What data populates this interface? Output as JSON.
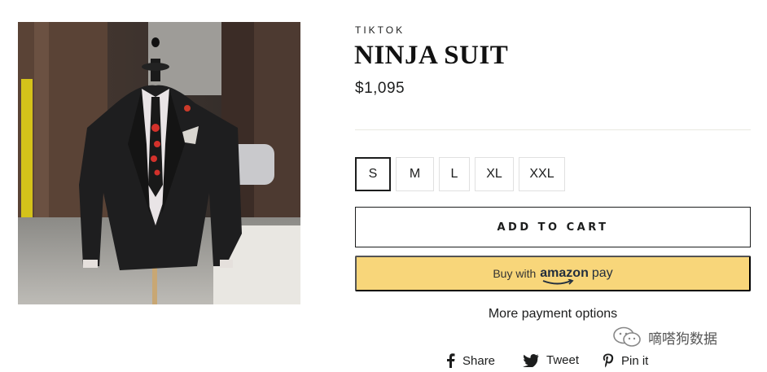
{
  "product": {
    "vendor": "TIKTOK",
    "title": "NINJA SUIT",
    "price": "$1,095",
    "image_icon": "product-photo"
  },
  "sizes": {
    "selected": "S",
    "options": [
      "S",
      "M",
      "L",
      "XL",
      "XXL"
    ]
  },
  "buttons": {
    "add_to_cart": "ADD TO CART",
    "amazon_buy_with": "Buy with",
    "amazon_brand": "amazon",
    "amazon_pay": "pay",
    "more_payment": "More payment options"
  },
  "social": {
    "share": "Share",
    "tweet": "Tweet",
    "pin": "Pin it"
  },
  "watermark": {
    "text": "嘀嗒狗数据"
  },
  "colors": {
    "amazon_button": "#f8d67a",
    "text": "#1c1d1d",
    "divider": "#e8e8e1"
  }
}
